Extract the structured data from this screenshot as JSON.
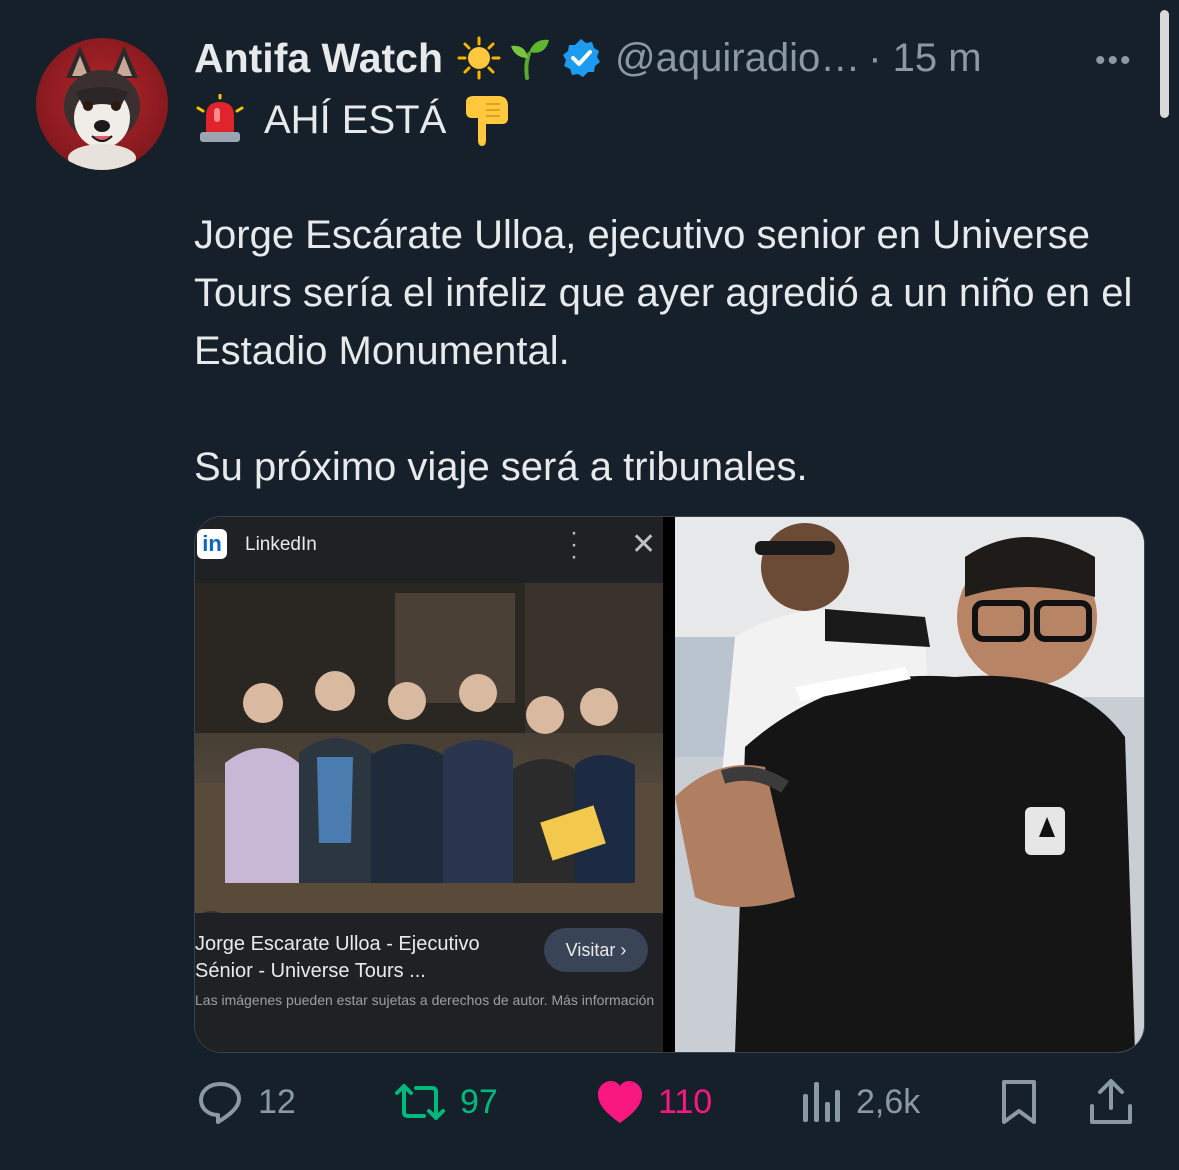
{
  "tweet": {
    "author_name": "Antifa Watch",
    "header_emojis": [
      "sun-emoji",
      "seedling-emoji"
    ],
    "handle": "@aquiradio…",
    "time": "· 15 m",
    "line1": "AHÍ ESTÁ",
    "body": [
      "Jorge Escárate Ulloa, ejecutivo senior en Universe Tours sería el infeliz que ayer agredió a un niño en el Estadio Monumental.",
      "Su próximo viaje será a tribunales."
    ]
  },
  "media": {
    "linkedin": {
      "site_name": "LinkedIn",
      "logo_text": "in",
      "result_title": "Jorge Escarate Ulloa - Ejecutivo Sénior - Universe Tours ...",
      "visit_label": "Visitar",
      "copyright_note": "Las imágenes pueden estar sujetas a derechos de autor. Más información"
    }
  },
  "actions": {
    "replies": "12",
    "retweets": "97",
    "likes": "110",
    "views": "2,6k"
  },
  "colors": {
    "background": "#15202b",
    "text": "#e7e9ea",
    "secondary": "#8b98a5",
    "verified": "#1d9bf0",
    "retweet": "#00ba7c",
    "like": "#f91880"
  }
}
